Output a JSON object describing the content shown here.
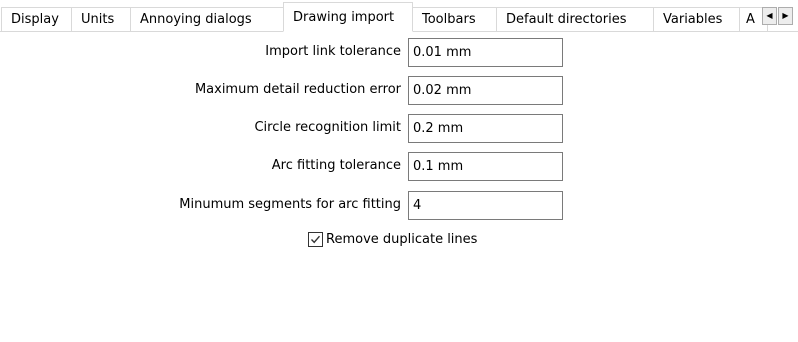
{
  "tabs": [
    {
      "label": "Display",
      "active": false
    },
    {
      "label": "Units",
      "active": false
    },
    {
      "label": "Annoying dialogs",
      "active": false
    },
    {
      "label": "Drawing import",
      "active": true
    },
    {
      "label": "Toolbars",
      "active": false
    },
    {
      "label": "Default directories",
      "active": false
    },
    {
      "label": "Variables",
      "active": false
    },
    {
      "label": "A",
      "active": false
    }
  ],
  "tab_scroll": {
    "left_glyph": "◀",
    "right_glyph": "▶",
    "left_icon": "scroll-left-arrow-icon",
    "right_icon": "scroll-right-arrow-icon"
  },
  "form": {
    "fields": [
      {
        "label": "Import link tolerance",
        "value": "0.01 mm"
      },
      {
        "label": "Maximum detail reduction error",
        "value": "0.02 mm"
      },
      {
        "label": "Circle recognition limit",
        "value": "0.2 mm"
      },
      {
        "label": "Arc fitting tolerance",
        "value": "0.1 mm"
      },
      {
        "label": "Minumum segments for arc fitting",
        "value": "4"
      }
    ],
    "checkbox": {
      "label": "Remove duplicate lines",
      "checked": true,
      "icon": "checkmark-icon"
    }
  }
}
